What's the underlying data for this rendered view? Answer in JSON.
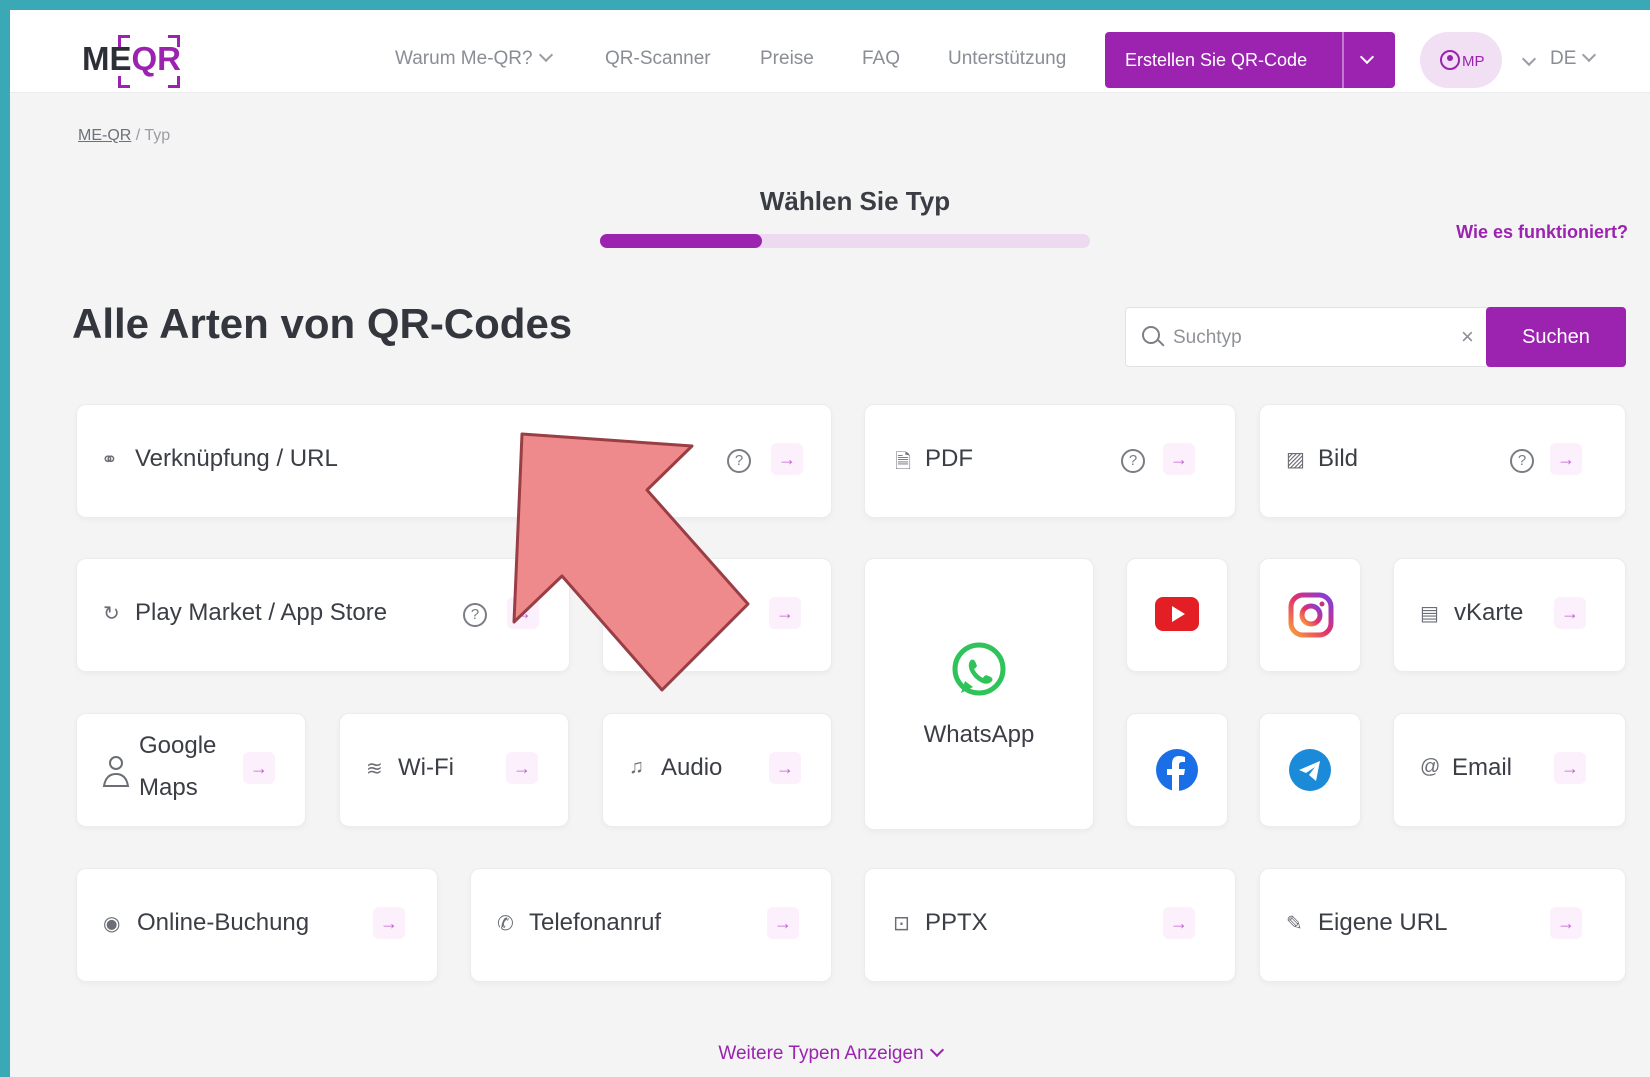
{
  "logo": {
    "text_me": "ME",
    "text_qr": "QR"
  },
  "nav": {
    "why": "Warum Me-QR?",
    "scanner": "QR-Scanner",
    "prices": "Preise",
    "faq": "FAQ",
    "support": "Unterstützung",
    "create_button": "Erstellen Sie QR-Code",
    "user_initials": "MP",
    "language": "DE"
  },
  "breadcrumb": {
    "home": "ME-QR",
    "separator": " / ",
    "current": "Typ"
  },
  "step": {
    "title": "Wählen Sie Typ",
    "progress": 0.33
  },
  "how_it_works": "Wie es funktioniert?",
  "heading": "Alle Arten von QR-Codes",
  "search": {
    "placeholder": "Suchtyp",
    "value": "",
    "clear": "×",
    "button": "Suchen"
  },
  "cards": {
    "url": {
      "label": "Verknüpfung / URL",
      "icon": "link-icon"
    },
    "pdf": {
      "label": "PDF",
      "icon": "pdf-file-icon"
    },
    "image": {
      "label": "Bild",
      "icon": "image-icon"
    },
    "app_store": {
      "label": "Play Market / App Store",
      "icon": "app-refresh-icon"
    },
    "whatsapp": {
      "label": "WhatsApp",
      "icon": "whatsapp-icon"
    },
    "youtube": {
      "icon": "youtube-icon"
    },
    "instagram": {
      "icon": "instagram-icon"
    },
    "vcard": {
      "label": "vKarte",
      "icon": "vcard-icon"
    },
    "google_maps": {
      "label_line1": "Google",
      "label_line2": "Maps",
      "icon": "map-person-icon"
    },
    "wifi": {
      "label": "Wi-Fi",
      "icon": "wifi-icon"
    },
    "audio": {
      "label": "Audio",
      "icon": "music-note-icon"
    },
    "facebook": {
      "icon": "facebook-icon"
    },
    "telegram": {
      "icon": "telegram-icon"
    },
    "email": {
      "label": "Email",
      "icon": "at-icon"
    },
    "booking": {
      "label": "Online-Buchung",
      "icon": "radio-dot-icon"
    },
    "phone": {
      "label": "Telefonanruf",
      "icon": "phone-icon"
    },
    "pptx": {
      "label": "PPTX",
      "icon": "presentation-icon"
    },
    "custom_url": {
      "label": "Eigene URL",
      "icon": "pencil-link-icon"
    }
  },
  "more_types": "Weitere Typen Anzeigen",
  "icons": {
    "help": "?",
    "arrow": "→"
  },
  "colors": {
    "brand": "#9b23b0",
    "annotation_arrow_fill": "#ee8a8c",
    "annotation_arrow_stroke": "#9a3e45",
    "outer_border": "#3aa9b5"
  }
}
